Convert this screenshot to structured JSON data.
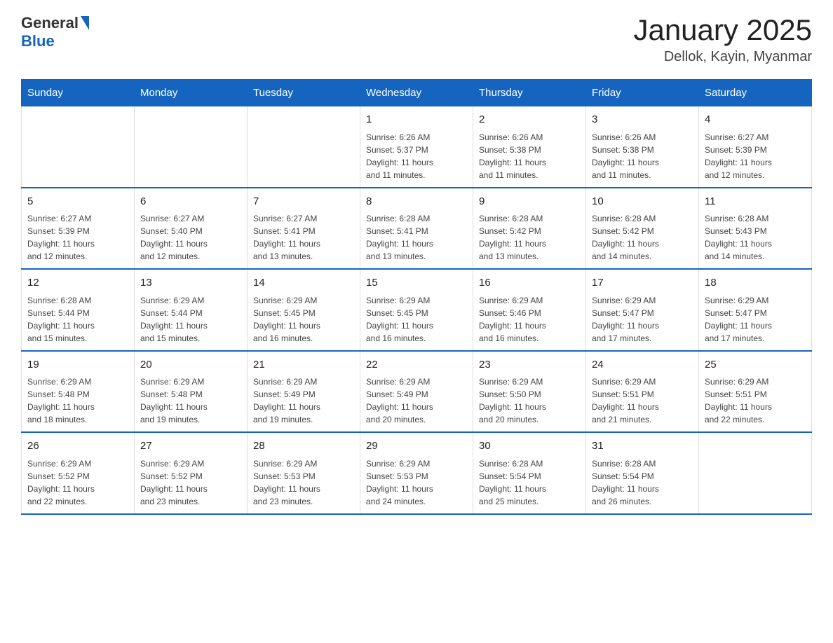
{
  "header": {
    "logo": {
      "general": "General",
      "blue": "Blue"
    },
    "title": "January 2025",
    "subtitle": "Dellok, Kayin, Myanmar"
  },
  "days_of_week": [
    "Sunday",
    "Monday",
    "Tuesday",
    "Wednesday",
    "Thursday",
    "Friday",
    "Saturday"
  ],
  "weeks": [
    [
      {
        "day": "",
        "info": ""
      },
      {
        "day": "",
        "info": ""
      },
      {
        "day": "",
        "info": ""
      },
      {
        "day": "1",
        "info": "Sunrise: 6:26 AM\nSunset: 5:37 PM\nDaylight: 11 hours\nand 11 minutes."
      },
      {
        "day": "2",
        "info": "Sunrise: 6:26 AM\nSunset: 5:38 PM\nDaylight: 11 hours\nand 11 minutes."
      },
      {
        "day": "3",
        "info": "Sunrise: 6:26 AM\nSunset: 5:38 PM\nDaylight: 11 hours\nand 11 minutes."
      },
      {
        "day": "4",
        "info": "Sunrise: 6:27 AM\nSunset: 5:39 PM\nDaylight: 11 hours\nand 12 minutes."
      }
    ],
    [
      {
        "day": "5",
        "info": "Sunrise: 6:27 AM\nSunset: 5:39 PM\nDaylight: 11 hours\nand 12 minutes."
      },
      {
        "day": "6",
        "info": "Sunrise: 6:27 AM\nSunset: 5:40 PM\nDaylight: 11 hours\nand 12 minutes."
      },
      {
        "day": "7",
        "info": "Sunrise: 6:27 AM\nSunset: 5:41 PM\nDaylight: 11 hours\nand 13 minutes."
      },
      {
        "day": "8",
        "info": "Sunrise: 6:28 AM\nSunset: 5:41 PM\nDaylight: 11 hours\nand 13 minutes."
      },
      {
        "day": "9",
        "info": "Sunrise: 6:28 AM\nSunset: 5:42 PM\nDaylight: 11 hours\nand 13 minutes."
      },
      {
        "day": "10",
        "info": "Sunrise: 6:28 AM\nSunset: 5:42 PM\nDaylight: 11 hours\nand 14 minutes."
      },
      {
        "day": "11",
        "info": "Sunrise: 6:28 AM\nSunset: 5:43 PM\nDaylight: 11 hours\nand 14 minutes."
      }
    ],
    [
      {
        "day": "12",
        "info": "Sunrise: 6:28 AM\nSunset: 5:44 PM\nDaylight: 11 hours\nand 15 minutes."
      },
      {
        "day": "13",
        "info": "Sunrise: 6:29 AM\nSunset: 5:44 PM\nDaylight: 11 hours\nand 15 minutes."
      },
      {
        "day": "14",
        "info": "Sunrise: 6:29 AM\nSunset: 5:45 PM\nDaylight: 11 hours\nand 16 minutes."
      },
      {
        "day": "15",
        "info": "Sunrise: 6:29 AM\nSunset: 5:45 PM\nDaylight: 11 hours\nand 16 minutes."
      },
      {
        "day": "16",
        "info": "Sunrise: 6:29 AM\nSunset: 5:46 PM\nDaylight: 11 hours\nand 16 minutes."
      },
      {
        "day": "17",
        "info": "Sunrise: 6:29 AM\nSunset: 5:47 PM\nDaylight: 11 hours\nand 17 minutes."
      },
      {
        "day": "18",
        "info": "Sunrise: 6:29 AM\nSunset: 5:47 PM\nDaylight: 11 hours\nand 17 minutes."
      }
    ],
    [
      {
        "day": "19",
        "info": "Sunrise: 6:29 AM\nSunset: 5:48 PM\nDaylight: 11 hours\nand 18 minutes."
      },
      {
        "day": "20",
        "info": "Sunrise: 6:29 AM\nSunset: 5:48 PM\nDaylight: 11 hours\nand 19 minutes."
      },
      {
        "day": "21",
        "info": "Sunrise: 6:29 AM\nSunset: 5:49 PM\nDaylight: 11 hours\nand 19 minutes."
      },
      {
        "day": "22",
        "info": "Sunrise: 6:29 AM\nSunset: 5:49 PM\nDaylight: 11 hours\nand 20 minutes."
      },
      {
        "day": "23",
        "info": "Sunrise: 6:29 AM\nSunset: 5:50 PM\nDaylight: 11 hours\nand 20 minutes."
      },
      {
        "day": "24",
        "info": "Sunrise: 6:29 AM\nSunset: 5:51 PM\nDaylight: 11 hours\nand 21 minutes."
      },
      {
        "day": "25",
        "info": "Sunrise: 6:29 AM\nSunset: 5:51 PM\nDaylight: 11 hours\nand 22 minutes."
      }
    ],
    [
      {
        "day": "26",
        "info": "Sunrise: 6:29 AM\nSunset: 5:52 PM\nDaylight: 11 hours\nand 22 minutes."
      },
      {
        "day": "27",
        "info": "Sunrise: 6:29 AM\nSunset: 5:52 PM\nDaylight: 11 hours\nand 23 minutes."
      },
      {
        "day": "28",
        "info": "Sunrise: 6:29 AM\nSunset: 5:53 PM\nDaylight: 11 hours\nand 23 minutes."
      },
      {
        "day": "29",
        "info": "Sunrise: 6:29 AM\nSunset: 5:53 PM\nDaylight: 11 hours\nand 24 minutes."
      },
      {
        "day": "30",
        "info": "Sunrise: 6:28 AM\nSunset: 5:54 PM\nDaylight: 11 hours\nand 25 minutes."
      },
      {
        "day": "31",
        "info": "Sunrise: 6:28 AM\nSunset: 5:54 PM\nDaylight: 11 hours\nand 26 minutes."
      },
      {
        "day": "",
        "info": ""
      }
    ]
  ]
}
